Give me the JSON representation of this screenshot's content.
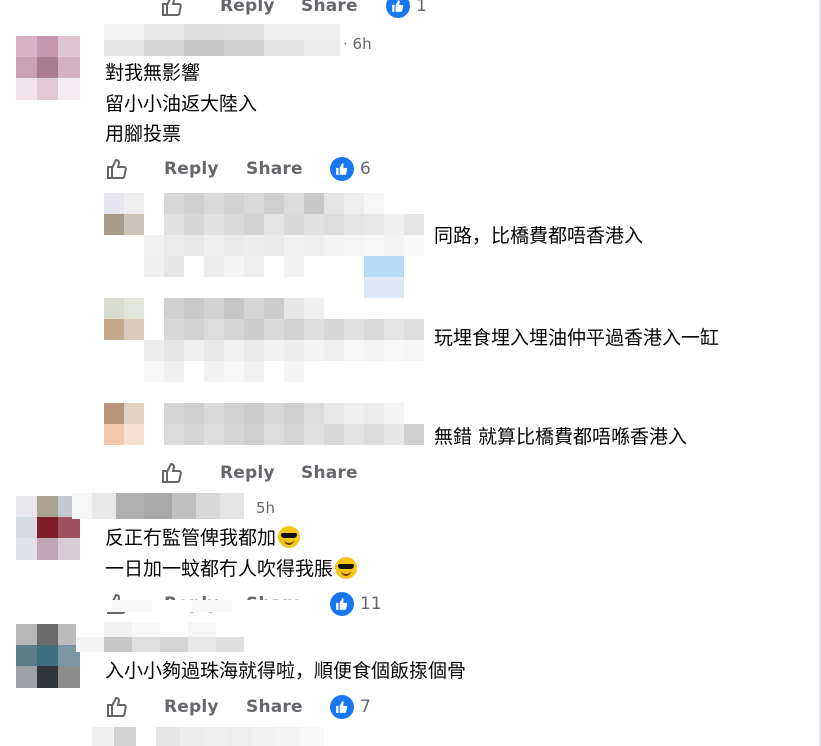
{
  "actions": {
    "reply": "Reply",
    "share": "Share"
  },
  "top_partial": {
    "like_count": "1"
  },
  "comments": [
    {
      "time": "· 6h",
      "lines": [
        "對我無影響",
        "留小小油返大陸入",
        "用腳投票"
      ],
      "like_count": "6",
      "replies": [
        {
          "text": "同路，比橋費都唔香港入"
        },
        {
          "text": "玩埋食埋入埋油仲平過香港入一缸"
        },
        {
          "text": "無錯 就算比橋費都唔喺香港入"
        }
      ]
    },
    {
      "time": "5h",
      "lines": [
        "反正冇監管俾我都加",
        "一日加一蚊都冇人吹得我脹"
      ],
      "like_count": "11"
    },
    {
      "lines": [
        "入小小夠過珠海就得啦，順便食個飯揼個骨"
      ],
      "like_count": "7"
    }
  ],
  "colors": {
    "like_blue": "#1877f2",
    "muted": "#65676b"
  },
  "icons": [
    "thumbs-up-outline-icon",
    "like-badge-icon",
    "sunglasses-emoji-icon"
  ]
}
